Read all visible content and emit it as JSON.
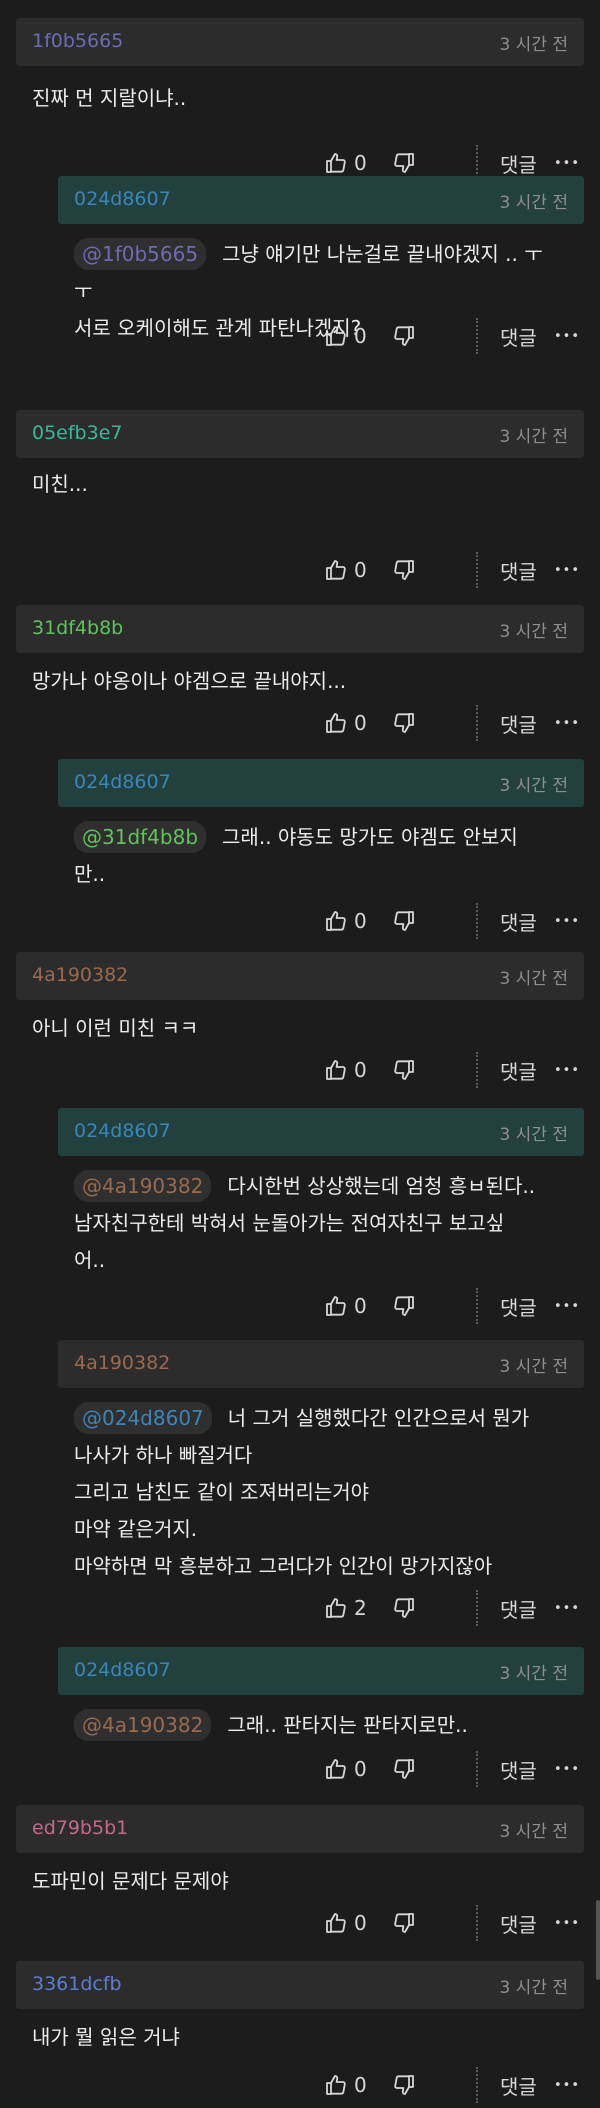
{
  "meta": {
    "reply_label": "댓글",
    "more_glyph": "•••"
  },
  "comments": [
    {
      "user": "1f0b5665",
      "user_color": "#6d6bb5",
      "time": "3 시간 전",
      "lines": [
        "진짜 먼 지랄이냐.."
      ],
      "likes": "0",
      "reply": false
    },
    {
      "user": "024d8607",
      "user_color": "#3b86b8",
      "time": "3 시간 전",
      "mention": "@1f0b5665",
      "mention_color": "#6d6bb5",
      "lines": [
        "그냥 얘기만 나눈걸로 끝내야겠지 .. ㅜ",
        "ㅜ",
        "서로 오케이해도 관계 파탄나겠지?"
      ],
      "likes": "0",
      "reply": true
    },
    {
      "user": "05efb3e7",
      "user_color": "#39b89a",
      "time": "3 시간 전",
      "lines": [
        "미친..."
      ],
      "likes": "0",
      "reply": false
    },
    {
      "user": "31df4b8b",
      "user_color": "#5fc45a",
      "time": "3 시간 전",
      "lines": [
        "망가나 야옹이나 야겜으로 끝내야지..."
      ],
      "likes": "0",
      "reply": false
    },
    {
      "user": "024d8607",
      "user_color": "#3b86b8",
      "time": "3 시간 전",
      "mention": "@31df4b8b",
      "mention_color": "#5fc45a",
      "lines": [
        "그래.. 야동도 망가도 야겜도 안보지",
        "만.."
      ],
      "likes": "0",
      "reply": true
    },
    {
      "user": "4a190382",
      "user_color": "#9a6a4e",
      "time": "3 시간 전",
      "lines": [
        "아니 이런 미친 ㅋㅋ"
      ],
      "likes": "0",
      "reply": false
    },
    {
      "user": "024d8607",
      "user_color": "#3b86b8",
      "time": "3 시간 전",
      "mention": "@4a190382",
      "mention_color": "#9a6a4e",
      "lines": [
        "다시한번 상상했는데 엄청 흥ㅂ된다..",
        "남자친구한테 박혀서 눈돌아가는 전여자친구 보고싶",
        "어.."
      ],
      "likes": "0",
      "reply": true
    },
    {
      "user": "4a190382",
      "user_color": "#9a6a4e",
      "time": "3 시간 전",
      "mention": "@024d8607",
      "mention_color": "#3b86b8",
      "lines": [
        "너 그거 실행했다간 인간으로서 뭔가",
        "나사가 하나 빠질거다",
        "그리고 남친도 같이 조져버리는거야",
        "마약 같은거지.",
        "마약하면 막 흥분하고 그러다가 인간이 망가지잖아"
      ],
      "likes": "2",
      "reply": true,
      "alt": true
    },
    {
      "user": "024d8607",
      "user_color": "#3b86b8",
      "time": "3 시간 전",
      "mention": "@4a190382",
      "mention_color": "#9a6a4e",
      "lines": [
        "그래.. 판타지는 판타지로만.."
      ],
      "likes": "0",
      "reply": true
    },
    {
      "user": "ed79b5b1",
      "user_color": "#c06a8c",
      "time": "3 시간 전",
      "lines": [
        "도파민이 문제다 문제야"
      ],
      "likes": "0",
      "reply": false
    },
    {
      "user": "3361dcfb",
      "user_color": "#5a7fd0",
      "time": "3 시간 전",
      "lines": [
        "내가 뭘 읽은 거냐"
      ],
      "likes": "0",
      "reply": false
    }
  ]
}
